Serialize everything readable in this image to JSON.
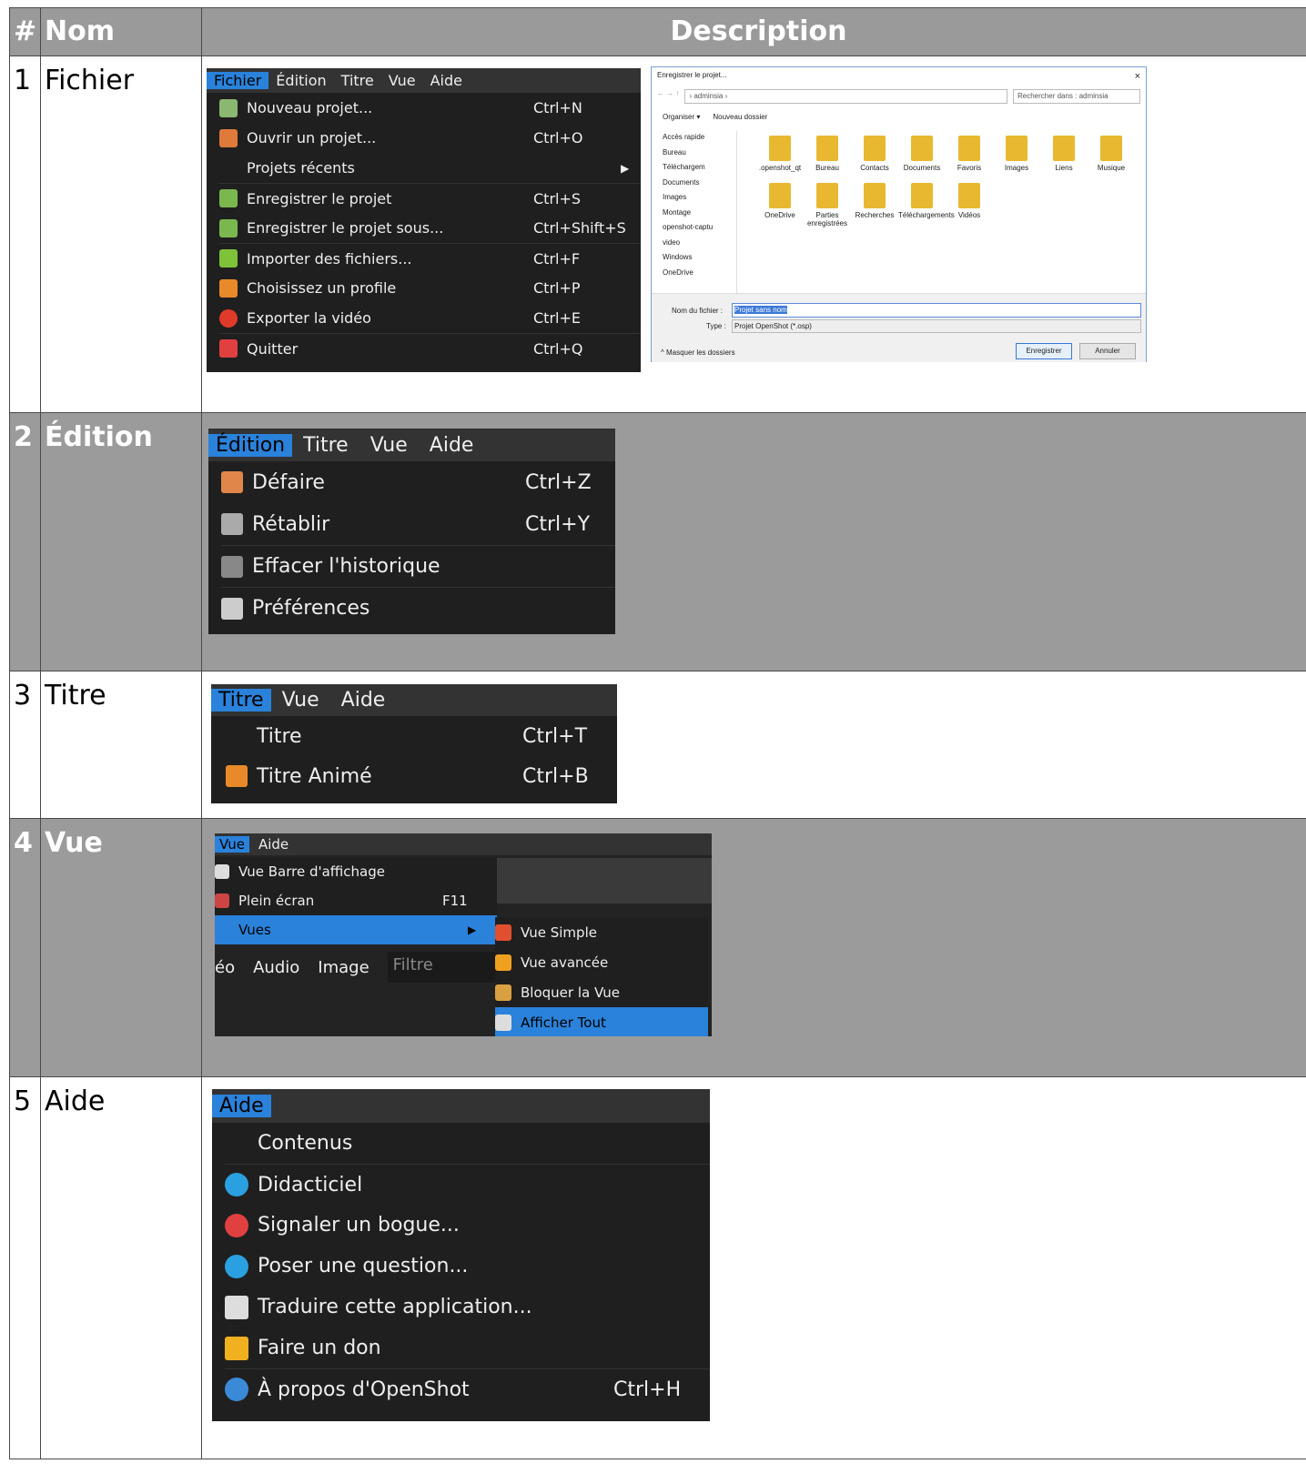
{
  "header": {
    "num": "#",
    "nom": "Nom",
    "desc": "Description"
  },
  "rows": [
    {
      "num": "1",
      "nom": "Fichier"
    },
    {
      "num": "2",
      "nom": "Édition"
    },
    {
      "num": "3",
      "nom": "Titre"
    },
    {
      "num": "4",
      "nom": "Vue"
    },
    {
      "num": "5",
      "nom": "Aide"
    }
  ],
  "fichier": {
    "bar": [
      "Fichier",
      "Édition",
      "Titre",
      "Vue",
      "Aide"
    ],
    "items": [
      {
        "label": "Nouveau projet...",
        "shortcut": "Ctrl+N",
        "icon": "new-project-icon",
        "color": "#8ab870"
      },
      {
        "label": "Ouvrir un projet...",
        "shortcut": "Ctrl+O",
        "icon": "open-folder-icon",
        "color": "#e07a3a"
      },
      {
        "label": "Projets récents",
        "shortcut": "",
        "icon": "",
        "color": ""
      },
      {
        "label": "Enregistrer le projet",
        "shortcut": "Ctrl+S",
        "icon": "save-icon",
        "color": "#7ab84e"
      },
      {
        "label": "Enregistrer le projet sous...",
        "shortcut": "Ctrl+Shift+S",
        "icon": "save-as-icon",
        "color": "#7ab84e"
      },
      {
        "label": "Importer des fichiers...",
        "shortcut": "Ctrl+F",
        "icon": "plus-icon",
        "color": "#7ec23a"
      },
      {
        "label": "Choisissez un profile",
        "shortcut": "Ctrl+P",
        "icon": "film-icon",
        "color": "#e88a2a"
      },
      {
        "label": "Exporter la vidéo",
        "shortcut": "Ctrl+E",
        "icon": "record-icon",
        "color": "#e03a2a"
      },
      {
        "label": "Quitter",
        "shortcut": "Ctrl+Q",
        "icon": "power-icon",
        "color": "#e04040"
      }
    ]
  },
  "dialog": {
    "title": "Enregistrer le projet...",
    "close": "×",
    "address": "› adminsia ›",
    "search_placeholder": "Rechercher dans : adminsia",
    "toolbar": [
      "Organiser ▾",
      "Nouveau dossier"
    ],
    "sidebar": [
      "Accès rapide",
      "Bureau",
      "Téléchargem",
      "Documents",
      "Images",
      "Montage",
      "openshot-captu",
      "video",
      "Windows",
      "OneDrive"
    ],
    "folders": [
      ".openshot_qt",
      "Bureau",
      "Contacts",
      "Documents",
      "Favoris",
      "Images",
      "Liens",
      "Musique",
      "OneDrive",
      "Parties enregistrées",
      "Recherches",
      "Téléchargements",
      "Vidéos"
    ],
    "filename_label": "Nom du fichier :",
    "filename": "Projet sans nom",
    "type_label": "Type :",
    "type": "Projet OpenShot (*.osp)",
    "hide_folders": "Masquer les dossiers",
    "save": "Enregistrer",
    "cancel": "Annuler"
  },
  "edition": {
    "bar": [
      "Édition",
      "Titre",
      "Vue",
      "Aide"
    ],
    "items": [
      {
        "label": "Défaire",
        "shortcut": "Ctrl+Z",
        "icon": "undo-icon",
        "color": "#e0864a"
      },
      {
        "label": "Rétablir",
        "shortcut": "Ctrl+Y",
        "icon": "redo-icon",
        "color": "#aaaaaa"
      },
      {
        "label": "Effacer l'historique",
        "shortcut": "",
        "icon": "clear-icon",
        "color": "#888888"
      },
      {
        "label": "Préférences",
        "shortcut": "",
        "icon": "gear-icon",
        "color": "#cccccc"
      }
    ]
  },
  "titre": {
    "bar": [
      "Titre",
      "Vue",
      "Aide"
    ],
    "items": [
      {
        "label": "Titre",
        "shortcut": "Ctrl+T",
        "icon": "",
        "color": ""
      },
      {
        "label": "Titre Animé",
        "shortcut": "Ctrl+B",
        "icon": "film-icon",
        "color": "#e88a2a"
      }
    ]
  },
  "vue": {
    "bar": [
      "Vue",
      "Aide"
    ],
    "items": [
      {
        "label": "Vue Barre d'affichage",
        "shortcut": "",
        "icon": "toolbar-icon",
        "color": "#dddddd"
      },
      {
        "label": "Plein écran",
        "shortcut": "F11",
        "icon": "fullscreen-icon",
        "color": "#cc4444"
      },
      {
        "label": "Vues",
        "shortcut": "",
        "icon": "",
        "color": ""
      }
    ],
    "background_tabs": [
      "éo",
      "Audio",
      "Image"
    ],
    "filter_placeholder": "Filtre",
    "submenu": [
      {
        "label": "Vue Simple",
        "icon": "home-icon",
        "color": "#e05030"
      },
      {
        "label": "Vue avancée",
        "icon": "star-icon",
        "color": "#f0a020"
      },
      {
        "label": "Bloquer la Vue",
        "icon": "lock-icon",
        "color": "#d8a040"
      },
      {
        "label": "Afficher Tout",
        "icon": "show-all-icon",
        "color": "#dddddd"
      }
    ]
  },
  "aide": {
    "bar": [
      "Aide"
    ],
    "items": [
      {
        "label": "Contenus",
        "shortcut": "",
        "icon": "",
        "color": ""
      },
      {
        "label": "Didacticiel",
        "shortcut": "",
        "icon": "chat-icon",
        "color": "#2aa0e0"
      },
      {
        "label": "Signaler un bogue...",
        "shortcut": "",
        "icon": "no-entry-icon",
        "color": "#e04040"
      },
      {
        "label": "Poser une question...",
        "shortcut": "",
        "icon": "chat-icon",
        "color": "#2aa0e0"
      },
      {
        "label": "Traduire cette application...",
        "shortcut": "",
        "icon": "user-icon",
        "color": "#dddddd"
      },
      {
        "label": "Faire un don",
        "shortcut": "",
        "icon": "star-icon",
        "color": "#f0b020"
      },
      {
        "label": "À propos d'OpenShot",
        "shortcut": "Ctrl+H",
        "icon": "info-icon",
        "color": "#3a8ad8"
      }
    ]
  }
}
